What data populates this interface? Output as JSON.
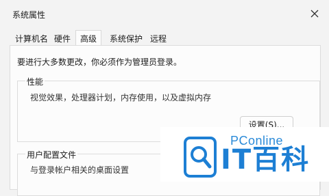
{
  "window": {
    "title": "系统属性"
  },
  "tabs": [
    {
      "label": "计算机名"
    },
    {
      "label": "硬件"
    },
    {
      "label": "高级"
    },
    {
      "label": "系统保护"
    },
    {
      "label": "远程"
    }
  ],
  "active_tab_index": 2,
  "notice": "要进行大多数更改，你必须作为管理员登录。",
  "performance": {
    "title": "性能",
    "description": "视觉效果，处理器计划，内存使用，以及虚拟内存",
    "button_label": "设置(S)..."
  },
  "user_profiles": {
    "title": "用户配置文件",
    "description": "与登录帐户相关的桌面设置"
  },
  "watermark": {
    "site": "PConline",
    "brand": "IT百科"
  },
  "icons": {
    "close": "close-icon",
    "logo": "magnifier-logo-icon"
  },
  "colors": {
    "accent": "#1d7fd4"
  }
}
